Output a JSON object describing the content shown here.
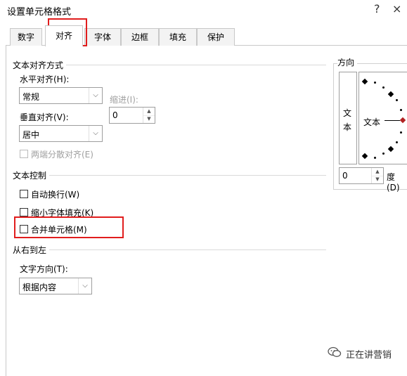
{
  "window": {
    "title": "设置单元格格式",
    "help_label": "?",
    "close_label": "×"
  },
  "tabs": [
    {
      "label": "数字"
    },
    {
      "label": "对齐"
    },
    {
      "label": "字体"
    },
    {
      "label": "边框"
    },
    {
      "label": "填充"
    },
    {
      "label": "保护"
    }
  ],
  "alignment": {
    "section_title": "文本对齐方式",
    "horizontal_label": "水平对齐(H):",
    "horizontal_value": "常规",
    "indent_label": "缩进(I):",
    "indent_value": "0",
    "vertical_label": "垂直对齐(V):",
    "vertical_value": "居中",
    "distributed_label": "两端分散对齐(E)"
  },
  "text_control": {
    "section_title": "文本控制",
    "wrap_label": "自动换行(W)",
    "shrink_label": "缩小字体填充(K)",
    "merge_label": "合并单元格(M)"
  },
  "rtl": {
    "section_title": "从右到左",
    "direction_label": "文字方向(T):",
    "direction_value": "根据内容"
  },
  "orientation": {
    "section_title": "方向",
    "vertical_text": "文本",
    "dial_text": "文本",
    "degree_value": "0",
    "degree_label": "度(D)"
  },
  "watermark": {
    "text": "正在讲营销",
    "icon": "wechat-icon"
  },
  "colors": {
    "highlight": "#e11d1d"
  }
}
